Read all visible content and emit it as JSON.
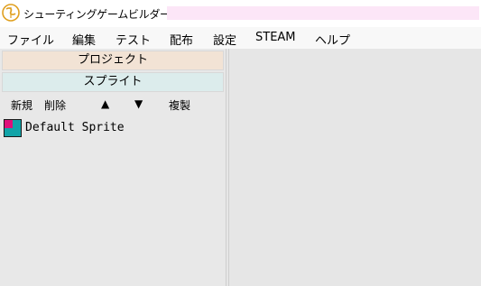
{
  "window": {
    "title": "シューティングゲームビルダー",
    "title_fill_color": "#fce6f7"
  },
  "menu": {
    "items": [
      "ファイル",
      "編集",
      "テスト",
      "配布",
      "設定",
      "STEAM",
      "ヘルプ"
    ]
  },
  "left_panel": {
    "project_header": "プロジェクト",
    "project_header_color": "#f2e3d5",
    "sprite_header": "スプライト",
    "sprite_header_color": "#dcecec",
    "toolbar": {
      "new_label": "新規",
      "delete_label": "削除",
      "up_label": "▲",
      "down_label": "▼",
      "copy_label": "複製"
    },
    "sprites": [
      {
        "name": "Default Sprite",
        "icon": "default-sprite-icon"
      }
    ]
  },
  "colors": {
    "panel_background": "#e6e6e6",
    "menubar_background": "#f8f8f8"
  }
}
